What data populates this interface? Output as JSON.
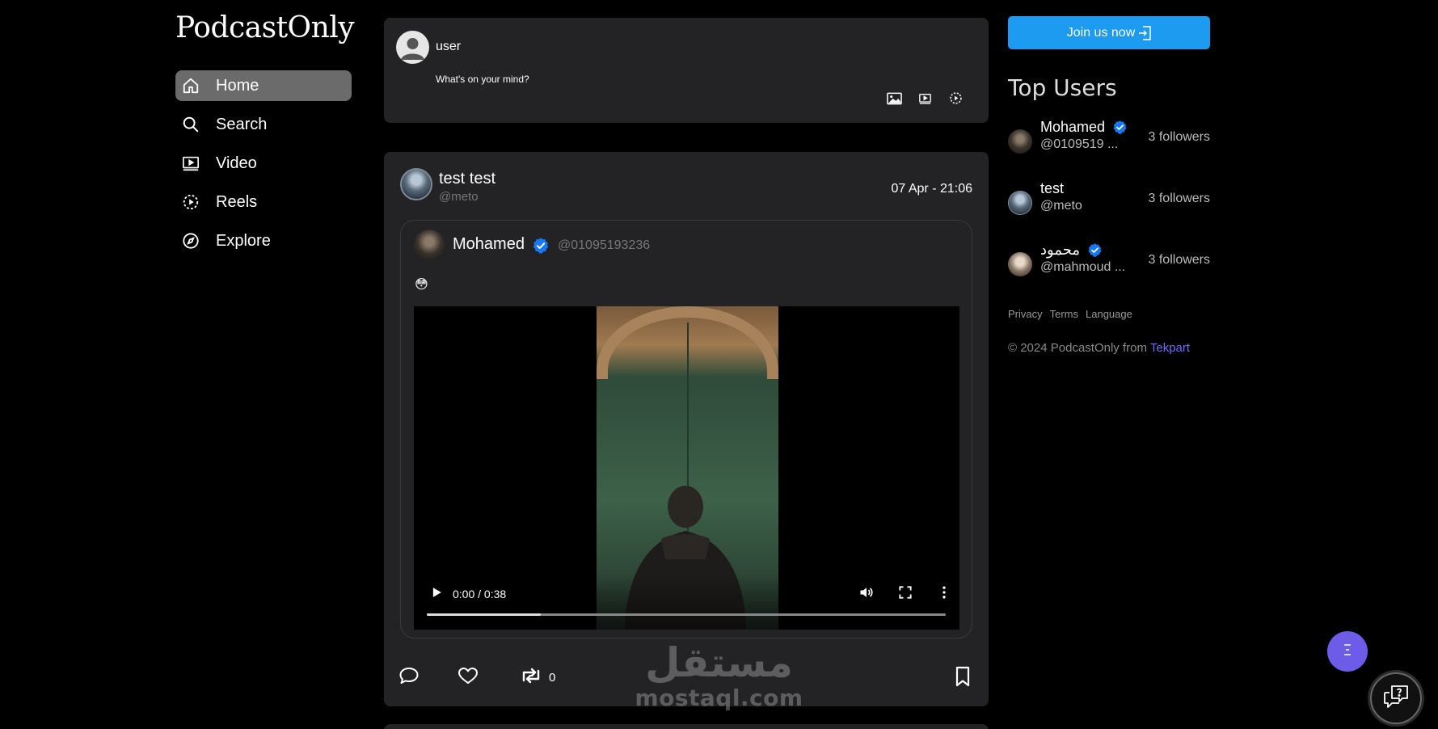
{
  "app": {
    "logo": "PodcastOnly"
  },
  "nav": {
    "items": [
      {
        "label": "Home",
        "icon": "home-icon",
        "active": true
      },
      {
        "label": "Search",
        "icon": "search-icon"
      },
      {
        "label": "Video",
        "icon": "video-icon"
      },
      {
        "label": "Reels",
        "icon": "reels-icon"
      },
      {
        "label": "Explore",
        "icon": "compass-icon"
      }
    ]
  },
  "composer": {
    "username": "user",
    "placeholder": "What's on your mind?",
    "tools": [
      "image-icon",
      "video-icon",
      "reels-icon"
    ]
  },
  "post": {
    "author_name": "test test",
    "author_handle": "@meto",
    "timestamp": "07 Apr - 21:06",
    "quoted": {
      "name": "Mohamed",
      "handle": "@01095193236",
      "verified": true,
      "text": "😳",
      "video": {
        "time": "0:00 / 0:38",
        "buffered": 0.22
      }
    },
    "repost_count": "0"
  },
  "sidebar": {
    "join_label": "Join us now",
    "top_users_title": "Top Users",
    "users": [
      {
        "name": "Mohamed",
        "handle": "@0109519 ...",
        "followers": "3 followers",
        "verified": true
      },
      {
        "name": "test",
        "handle": "@meto",
        "followers": "3 followers",
        "verified": false
      },
      {
        "name": "محمود",
        "handle": "@mahmoud ...",
        "followers": "3 followers",
        "verified": true
      }
    ],
    "links": [
      "Privacy",
      "Terms",
      "Language"
    ],
    "copyright_prefix": "© 2024 PodcastOnly from ",
    "copyright_brand": "Tekpart"
  },
  "watermark": {
    "arabic": "مستقل",
    "latin": "mostaql.com"
  },
  "colors": {
    "accent_blue": "#1d9bf0",
    "verified_blue": "#1877f2",
    "fab_purple": "#6c5ce7",
    "card_bg": "#232326",
    "brand_link": "#6b6bff"
  }
}
